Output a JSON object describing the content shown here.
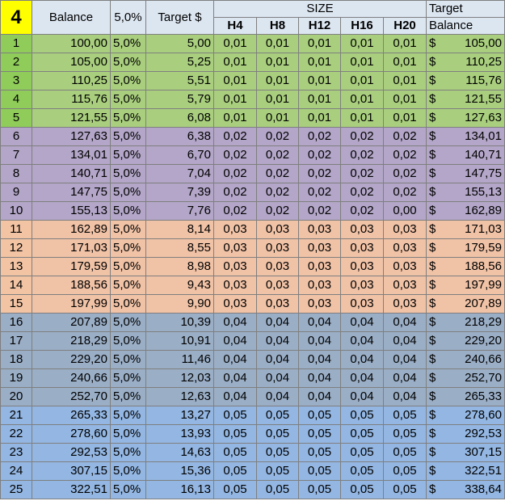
{
  "sheet": {
    "corner_label": "4",
    "headers": {
      "balance": "Balance",
      "rate": "5,0%",
      "target": "Target $",
      "size_group": "SIZE",
      "size_cols": [
        "H4",
        "H8",
        "H12",
        "H16",
        "H20"
      ],
      "final_top": "Target",
      "final_bottom": "Balance"
    },
    "currency_symbol": "$",
    "rows": [
      {
        "n": "1",
        "balance": "100,00",
        "rate": "5,0%",
        "target": "5,00",
        "s": [
          "0,01",
          "0,01",
          "0,01",
          "0,01",
          "0,01"
        ],
        "final": "105,00",
        "group": "g1"
      },
      {
        "n": "2",
        "balance": "105,00",
        "rate": "5,0%",
        "target": "5,25",
        "s": [
          "0,01",
          "0,01",
          "0,01",
          "0,01",
          "0,01"
        ],
        "final": "110,25",
        "group": "g1"
      },
      {
        "n": "3",
        "balance": "110,25",
        "rate": "5,0%",
        "target": "5,51",
        "s": [
          "0,01",
          "0,01",
          "0,01",
          "0,01",
          "0,01"
        ],
        "final": "115,76",
        "group": "g1"
      },
      {
        "n": "4",
        "balance": "115,76",
        "rate": "5,0%",
        "target": "5,79",
        "s": [
          "0,01",
          "0,01",
          "0,01",
          "0,01",
          "0,01"
        ],
        "final": "121,55",
        "group": "g1"
      },
      {
        "n": "5",
        "balance": "121,55",
        "rate": "5,0%",
        "target": "6,08",
        "s": [
          "0,01",
          "0,01",
          "0,01",
          "0,01",
          "0,01"
        ],
        "final": "127,63",
        "group": "g1"
      },
      {
        "n": "6",
        "balance": "127,63",
        "rate": "5,0%",
        "target": "6,38",
        "s": [
          "0,02",
          "0,02",
          "0,02",
          "0,02",
          "0,02"
        ],
        "final": "134,01",
        "group": "g2"
      },
      {
        "n": "7",
        "balance": "134,01",
        "rate": "5,0%",
        "target": "6,70",
        "s": [
          "0,02",
          "0,02",
          "0,02",
          "0,02",
          "0,02"
        ],
        "final": "140,71",
        "group": "g2"
      },
      {
        "n": "8",
        "balance": "140,71",
        "rate": "5,0%",
        "target": "7,04",
        "s": [
          "0,02",
          "0,02",
          "0,02",
          "0,02",
          "0,02"
        ],
        "final": "147,75",
        "group": "g2"
      },
      {
        "n": "9",
        "balance": "147,75",
        "rate": "5,0%",
        "target": "7,39",
        "s": [
          "0,02",
          "0,02",
          "0,02",
          "0,02",
          "0,02"
        ],
        "final": "155,13",
        "group": "g2"
      },
      {
        "n": "10",
        "balance": "155,13",
        "rate": "5,0%",
        "target": "7,76",
        "s": [
          "0,02",
          "0,02",
          "0,02",
          "0,02",
          "0,00"
        ],
        "final": "162,89",
        "group": "g2"
      },
      {
        "n": "11",
        "balance": "162,89",
        "rate": "5,0%",
        "target": "8,14",
        "s": [
          "0,03",
          "0,03",
          "0,03",
          "0,03",
          "0,03"
        ],
        "final": "171,03",
        "group": "g3"
      },
      {
        "n": "12",
        "balance": "171,03",
        "rate": "5,0%",
        "target": "8,55",
        "s": [
          "0,03",
          "0,03",
          "0,03",
          "0,03",
          "0,03"
        ],
        "final": "179,59",
        "group": "g3"
      },
      {
        "n": "13",
        "balance": "179,59",
        "rate": "5,0%",
        "target": "8,98",
        "s": [
          "0,03",
          "0,03",
          "0,03",
          "0,03",
          "0,03"
        ],
        "final": "188,56",
        "group": "g3"
      },
      {
        "n": "14",
        "balance": "188,56",
        "rate": "5,0%",
        "target": "9,43",
        "s": [
          "0,03",
          "0,03",
          "0,03",
          "0,03",
          "0,03"
        ],
        "final": "197,99",
        "group": "g3"
      },
      {
        "n": "15",
        "balance": "197,99",
        "rate": "5,0%",
        "target": "9,90",
        "s": [
          "0,03",
          "0,03",
          "0,03",
          "0,03",
          "0,03"
        ],
        "final": "207,89",
        "group": "g3"
      },
      {
        "n": "16",
        "balance": "207,89",
        "rate": "5,0%",
        "target": "10,39",
        "s": [
          "0,04",
          "0,04",
          "0,04",
          "0,04",
          "0,04"
        ],
        "final": "218,29",
        "group": "g4"
      },
      {
        "n": "17",
        "balance": "218,29",
        "rate": "5,0%",
        "target": "10,91",
        "s": [
          "0,04",
          "0,04",
          "0,04",
          "0,04",
          "0,04"
        ],
        "final": "229,20",
        "group": "g4"
      },
      {
        "n": "18",
        "balance": "229,20",
        "rate": "5,0%",
        "target": "11,46",
        "s": [
          "0,04",
          "0,04",
          "0,04",
          "0,04",
          "0,04"
        ],
        "final": "240,66",
        "group": "g4"
      },
      {
        "n": "19",
        "balance": "240,66",
        "rate": "5,0%",
        "target": "12,03",
        "s": [
          "0,04",
          "0,04",
          "0,04",
          "0,04",
          "0,04"
        ],
        "final": "252,70",
        "group": "g4"
      },
      {
        "n": "20",
        "balance": "252,70",
        "rate": "5,0%",
        "target": "12,63",
        "s": [
          "0,04",
          "0,04",
          "0,04",
          "0,04",
          "0,04"
        ],
        "final": "265,33",
        "group": "g4"
      },
      {
        "n": "21",
        "balance": "265,33",
        "rate": "5,0%",
        "target": "13,27",
        "s": [
          "0,05",
          "0,05",
          "0,05",
          "0,05",
          "0,05"
        ],
        "final": "278,60",
        "group": "g5"
      },
      {
        "n": "22",
        "balance": "278,60",
        "rate": "5,0%",
        "target": "13,93",
        "s": [
          "0,05",
          "0,05",
          "0,05",
          "0,05",
          "0,05"
        ],
        "final": "292,53",
        "group": "g5"
      },
      {
        "n": "23",
        "balance": "292,53",
        "rate": "5,0%",
        "target": "14,63",
        "s": [
          "0,05",
          "0,05",
          "0,05",
          "0,05",
          "0,05"
        ],
        "final": "307,15",
        "group": "g5"
      },
      {
        "n": "24",
        "balance": "307,15",
        "rate": "5,0%",
        "target": "15,36",
        "s": [
          "0,05",
          "0,05",
          "0,05",
          "0,05",
          "0,05"
        ],
        "final": "322,51",
        "group": "g5"
      },
      {
        "n": "25",
        "balance": "322,51",
        "rate": "5,0%",
        "target": "16,13",
        "s": [
          "0,05",
          "0,05",
          "0,05",
          "0,05",
          "0,05"
        ],
        "final": "338,64",
        "group": "g5"
      }
    ]
  }
}
